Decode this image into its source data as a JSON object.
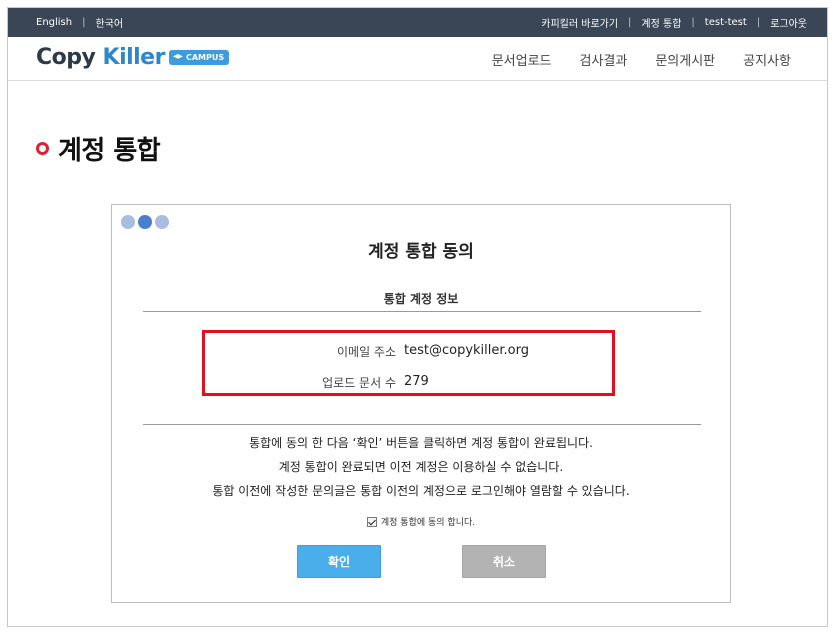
{
  "topbar": {
    "languages": [
      "English",
      "한국어"
    ],
    "links": [
      "카피킬러 바로가기",
      "계정 통합",
      "test-test",
      "로그아웃"
    ]
  },
  "logo": {
    "text_main": "Copy ",
    "text_k": "Killer",
    "badge": "CAMPUS"
  },
  "nav": [
    "문서업로드",
    "검사결과",
    "문의게시판",
    "공지사항"
  ],
  "page": {
    "title": "계정 통합"
  },
  "panel": {
    "title": "계정 통합 동의",
    "section_title": "통합 계정 정보",
    "email_label": "이메일 주소",
    "email_value": "test@copykiller.org",
    "count_label": "업로드 문서 수",
    "count_value": "279",
    "notice": [
      "통합에 동의 한 다음 ‘확인’ 버튼을 클릭하면 계정 통합이 완료됩니다.",
      "계정 통합이 완료되면 이전 계정은 이용하실 수 없습니다.",
      "통합 이전에 작성한 문의글은 통합 이전의 계정으로 로그인해야 열람할 수 있습니다."
    ],
    "agree_label": "계정 통합에 동의 합니다.",
    "agree_checked": true,
    "confirm_label": "확인",
    "cancel_label": "취소",
    "steps_total": 3,
    "steps_active": 2
  },
  "colors": {
    "topbar_bg": "#3a4555",
    "accent_red": "#e0202f",
    "confirm_btn": "#4aaeea",
    "cancel_btn": "#b3b3b3",
    "step_active": "#4a7fd0",
    "step_inactive": "#a9bde0"
  }
}
